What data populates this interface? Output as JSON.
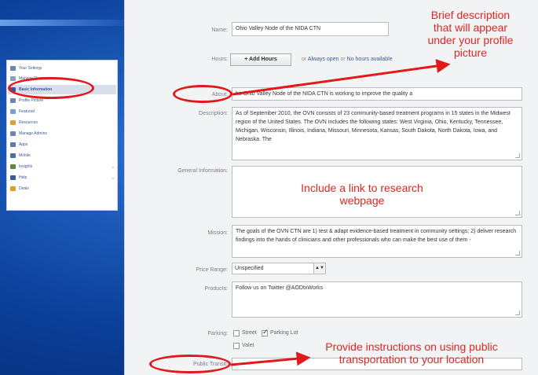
{
  "sidebar": {
    "items": [
      {
        "label": "Your Settings",
        "color": "#6d84b4"
      },
      {
        "label": "Manage Permissions",
        "color": "#8aa0c8"
      },
      {
        "label": "Basic Information",
        "color": "#3b5998"
      },
      {
        "label": "Profile Picture",
        "color": "#6d84b4"
      },
      {
        "label": "Featured",
        "color": "#7c9cd6"
      },
      {
        "label": "Resources",
        "color": "#e0a030"
      },
      {
        "label": "Manage Admins",
        "color": "#6d84b4"
      },
      {
        "label": "Apps",
        "color": "#5a7ab0"
      },
      {
        "label": "Mobile",
        "color": "#4c6fa8"
      },
      {
        "label": "Insights",
        "color": "#5b8a3a"
      },
      {
        "label": "Help",
        "color": "#3b5998"
      },
      {
        "label": "Deals",
        "color": "#d8a020"
      }
    ]
  },
  "form": {
    "name_label": "Name:",
    "name_value": "Ohio Valley Node of the NIDA CTN",
    "hours_label": "Hours:",
    "add_hours": "+ Add Hours",
    "hours_or": "or",
    "hours_always": "Always open",
    "hours_or2": "or",
    "hours_none": "No hours available",
    "about_label": "About:",
    "about_value": "he Ohio Valley Node of the NIDA CTN is working to improve the quality a",
    "description_label": "Description:",
    "description_value": "As of September 2010, the OVN consists of 23 community-based treatment programs in 15 states in the Midwest region of the United States. The OVN includes the following states: West Virginia, Ohio, Kentucky, Tennessee, Michigan, Wisconsin, Illinois, Indiana, Missouri, Minnesota, Kansas, South Dakota, North Dakota, Iowa, and Nebraska. The",
    "general_label": "General Information:",
    "mission_label": "Mission:",
    "mission_value": "The goals of the OVN CTN are 1) test & adapt evidence-based treatment in community settings; 2) deliver research findings into the hands of clinicians and other professionals who can make the best use of them -",
    "price_label": "Price Range:",
    "price_value": "Unspecified",
    "products_label": "Products:",
    "products_value": "Follow us on Twitter @AODtxWorks",
    "parking_label": "Parking:",
    "parking_street": "Street",
    "parking_lot": "Parking Lot",
    "parking_valet": "Valet",
    "transit_label": "Public Transit:"
  },
  "annotations": {
    "about_note": [
      "Brief description",
      "that will appear",
      "under your profile",
      "picture"
    ],
    "general_note": [
      "Include a link to research",
      "webpage"
    ],
    "transit_note": [
      "Provide instructions on using public",
      "transportation to your location"
    ]
  }
}
